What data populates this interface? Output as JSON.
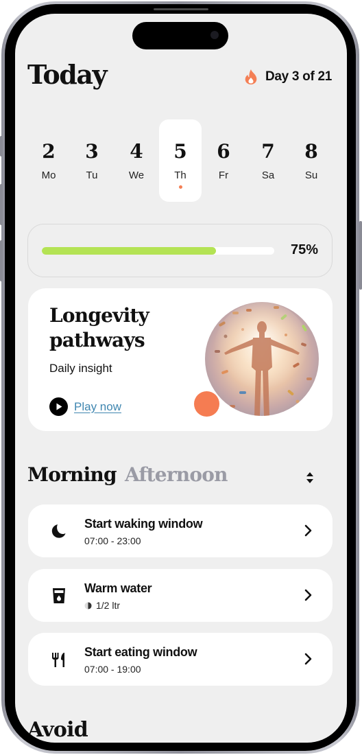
{
  "header": {
    "title": "Today",
    "streak_icon": "flame-icon",
    "streak_text": "Day 3 of 21",
    "accent_color": "#f47f55"
  },
  "week": {
    "selected_index": 3,
    "days": [
      {
        "number": "2",
        "label": "Mo"
      },
      {
        "number": "3",
        "label": "Tu"
      },
      {
        "number": "4",
        "label": "We"
      },
      {
        "number": "5",
        "label": "Th"
      },
      {
        "number": "6",
        "label": "Fr"
      },
      {
        "number": "7",
        "label": "Sa"
      },
      {
        "number": "8",
        "label": "Su"
      }
    ]
  },
  "progress": {
    "percent": 75,
    "label": "75%",
    "fill_color": "#b4e354"
  },
  "insight": {
    "title_line1": "Longevity",
    "title_line2": "pathways",
    "subtitle": "Daily insight",
    "play_label": "Play now",
    "image_alt": "Glowing human figure surrounded by floating pills"
  },
  "schedule": {
    "tabs": [
      {
        "label": "Morning",
        "active": true
      },
      {
        "label": "Afternoon",
        "active": false
      }
    ],
    "sort_icon": "sort-icon",
    "items": [
      {
        "icon": "moon-icon",
        "title": "Start waking window",
        "subtitle": "07:00 - 23:00"
      },
      {
        "icon": "water-glass-icon",
        "title": "Warm water",
        "subtitle": "1/2 ltr",
        "sub_icon": "half-circle-icon"
      },
      {
        "icon": "utensils-icon",
        "title": "Start eating window",
        "subtitle": "07:00 - 19:00"
      }
    ]
  },
  "avoid": {
    "title": "Avoid"
  }
}
